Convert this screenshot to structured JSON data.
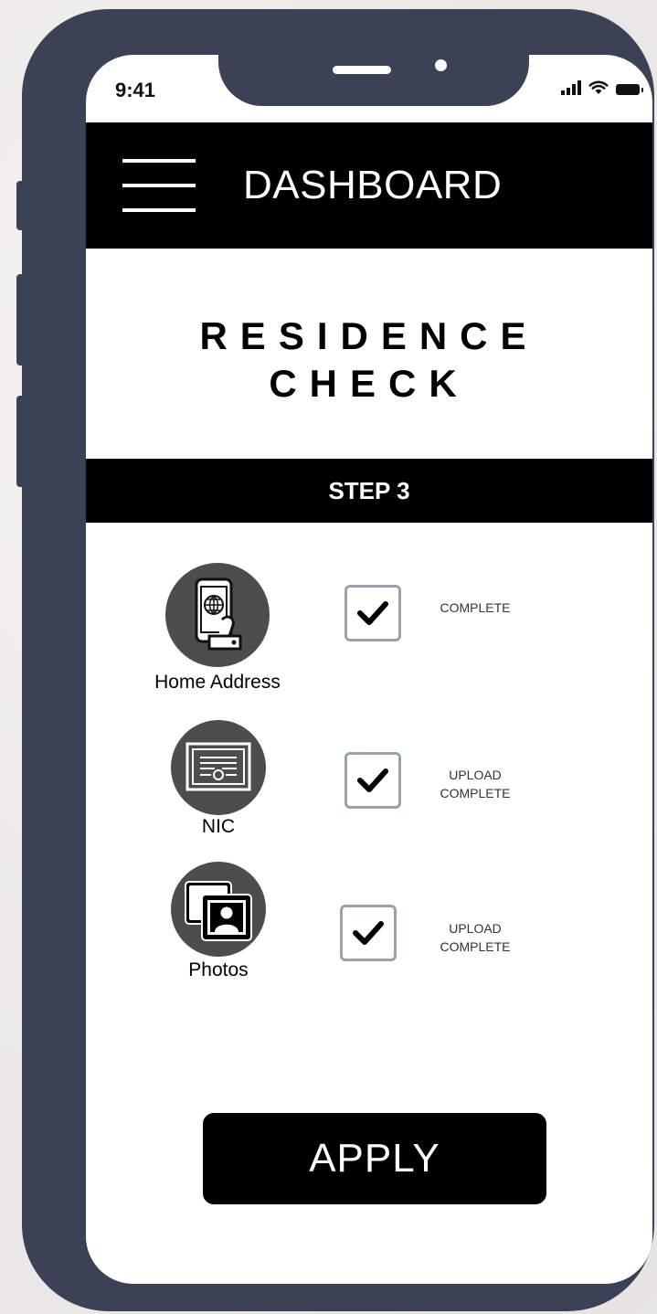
{
  "status_bar": {
    "time": "9:41"
  },
  "header": {
    "title": "DASHBOARD"
  },
  "page": {
    "title_line1": "RESIDENCE",
    "title_line2": "CHECK",
    "step": "STEP 3"
  },
  "items": [
    {
      "label": "Home Address",
      "status_line1": "",
      "status_line2": "COMPLETE",
      "icon": "mobile-passport-icon"
    },
    {
      "label": "NIC",
      "status_line1": "UPLOAD",
      "status_line2": "COMPLETE",
      "icon": "id-card-icon"
    },
    {
      "label": "Photos",
      "status_line1": "UPLOAD",
      "status_line2": "COMPLETE",
      "icon": "photos-icon"
    }
  ],
  "apply_button": {
    "label": "APPLY"
  }
}
